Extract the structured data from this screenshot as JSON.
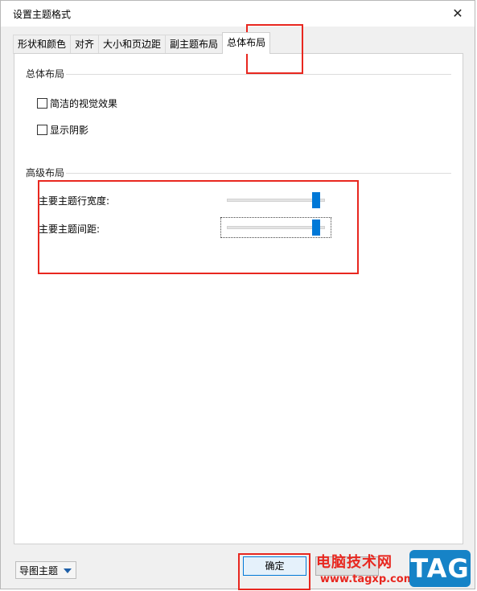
{
  "dialog": {
    "title": "设置主题格式",
    "close_symbol": "✕"
  },
  "tabs": [
    {
      "label": "形状和颜色"
    },
    {
      "label": "对齐"
    },
    {
      "label": "大小和页边距"
    },
    {
      "label": "副主题布局"
    },
    {
      "label": "总体布局",
      "active": true
    }
  ],
  "overall_layout": {
    "header": "总体布局",
    "options": [
      {
        "label": "简洁的视觉效果",
        "checked": false
      },
      {
        "label": "显示阴影",
        "checked": false
      }
    ]
  },
  "advanced_layout": {
    "header": "高级布局",
    "sliders": [
      {
        "label": "主要主题行宽度:",
        "value_fraction": 0.95
      },
      {
        "label": "主要主题间距:",
        "value_fraction": 0.95
      }
    ]
  },
  "footer": {
    "dropdown_label": "导图主题",
    "ok_label": "确定"
  },
  "watermark": {
    "site_name": "电脑技术网",
    "url": "www.tagxp.com",
    "badge": "TAG"
  },
  "colors": {
    "accent": "#0078d7",
    "annotation": "#e8271f",
    "badge": "#1683c7"
  }
}
